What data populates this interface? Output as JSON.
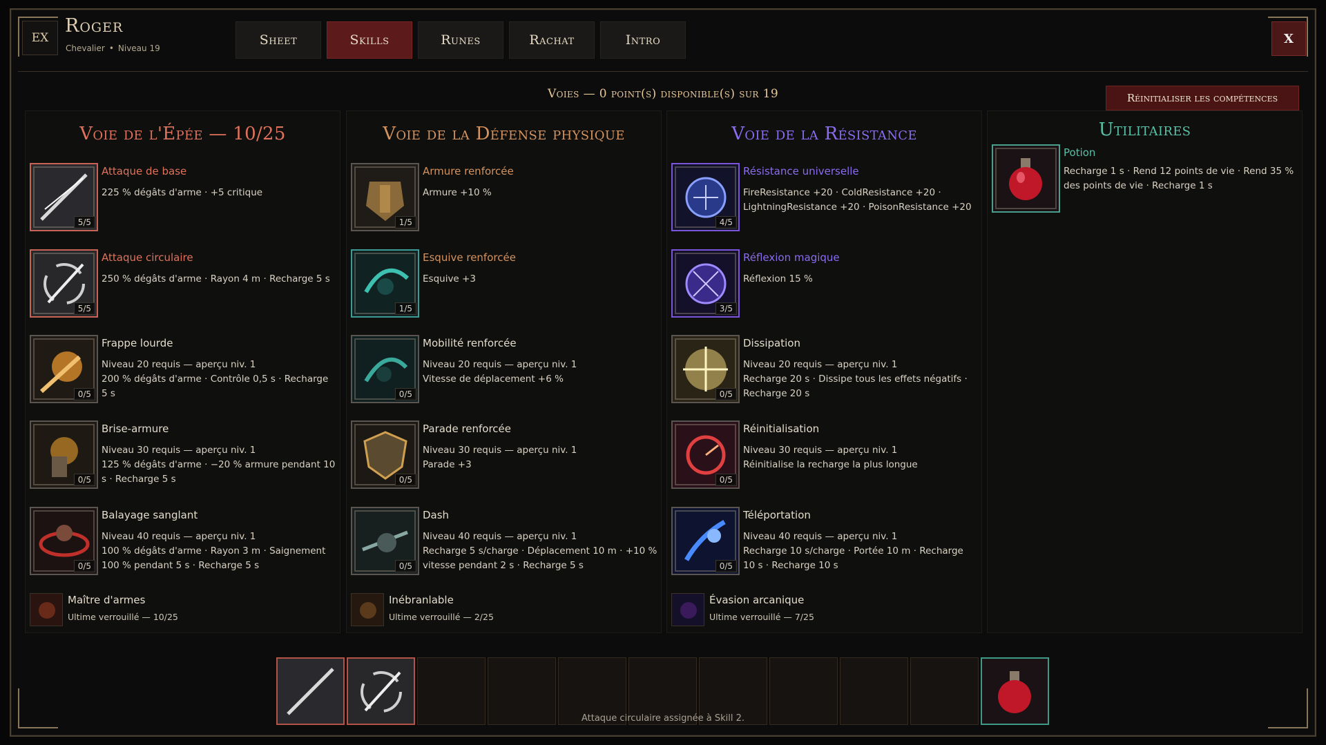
{
  "header": {
    "brand": "EX",
    "name": "Roger",
    "class": "Chevalier",
    "level": "Niveau 19",
    "close": "X"
  },
  "tabs": [
    {
      "label": "Sheet",
      "active": false
    },
    {
      "label": "Skills",
      "active": true
    },
    {
      "label": "Runes",
      "active": false
    },
    {
      "label": "Rachat",
      "active": false
    },
    {
      "label": "Intro",
      "active": false
    }
  ],
  "points_text": "Voies — 0 point(s) disponible(s) sur 19",
  "reset_label": "Réinitialiser les compétences",
  "colors": {
    "epee": "#e0725c",
    "defense": "#d4935e",
    "resist": "#8a6cf0",
    "util": "#58c0a6"
  },
  "paths": {
    "epee": {
      "title": "Voie de l'Épée — 10/25",
      "skills": [
        {
          "name": "Attaque de base",
          "desc": "225 % dégâts d'arme · +5 critique",
          "level": "5/5",
          "icon": "sword-slash-icon"
        },
        {
          "name": "Attaque circulaire",
          "desc": "250 % dégâts d'arme · Rayon 4 m · Recharge 5 s",
          "level": "5/5",
          "icon": "whirlwind-slash-icon"
        },
        {
          "name": "Frappe lourde",
          "desc": "Niveau 20 requis — aperçu niv. 1",
          "desc2": "200 % dégâts d'arme · Contrôle 0,5 s · Recharge 5 s",
          "level": "0/5",
          "icon": "heavy-strike-icon"
        },
        {
          "name": "Brise-armure",
          "desc": "Niveau 30 requis — aperçu niv. 1",
          "desc2": "125 % dégâts d'arme · −20 % armure pendant 10 s · Recharge 5 s",
          "level": "0/5",
          "icon": "armor-break-icon"
        },
        {
          "name": "Balayage sanglant",
          "desc": "Niveau 40 requis — aperçu niv. 1",
          "desc2": "100 % dégâts d'arme · Rayon 3 m · Saignement 100 % pendant 5 s · Recharge 5 s",
          "level": "0/5",
          "icon": "bloody-sweep-icon"
        }
      ],
      "ultimate": {
        "name": "Maître d'armes",
        "lock": "Ultime verrouillé — 10/25"
      }
    },
    "defense": {
      "title": "Voie de la Défense physique",
      "skills": [
        {
          "name": "Armure renforcée",
          "desc": "Armure +10 %",
          "level": "1/5",
          "icon": "armor-icon"
        },
        {
          "name": "Esquive renforcée",
          "desc": "Esquive +3",
          "level": "1/5",
          "icon": "dodge-icon"
        },
        {
          "name": "Mobilité renforcée",
          "desc": "Niveau 20 requis — aperçu niv. 1",
          "desc2": "Vitesse de déplacement +6 %",
          "level": "0/5",
          "icon": "mobility-icon"
        },
        {
          "name": "Parade renforcée",
          "desc": "Niveau 30 requis — aperçu niv. 1",
          "desc2": "Parade +3",
          "level": "0/5",
          "icon": "shield-icon"
        },
        {
          "name": "Dash",
          "desc": "Niveau 40 requis — aperçu niv. 1",
          "desc2": "Recharge 5 s/charge · Déplacement 10 m · +10 % vitesse pendant 2 s · Recharge 5 s",
          "level": "0/5",
          "icon": "dash-icon"
        }
      ],
      "ultimate": {
        "name": "Inébranlable",
        "lock": "Ultime verrouillé — 2/25"
      }
    },
    "resist": {
      "title": "Voie de la Résistance",
      "skills": [
        {
          "name": "Résistance universelle",
          "desc": "FireResistance +20 · ColdResistance +20 ·",
          "desc2": "LightningResistance +20 · PoisonResistance +20",
          "level": "4/5",
          "icon": "resistance-shield-icon"
        },
        {
          "name": "Réflexion magique",
          "desc": "Réflexion 15 %",
          "level": "3/5",
          "icon": "magic-reflect-icon"
        },
        {
          "name": "Dissipation",
          "desc": "Niveau 20 requis — aperçu niv. 1",
          "desc2": "Recharge 20 s · Dissipe tous les effets négatifs · Recharge 20 s",
          "level": "0/5",
          "icon": "dispel-icon"
        },
        {
          "name": "Réinitialisation",
          "desc": "Niveau 30 requis — aperçu niv. 1",
          "desc2": "Réinitialise la recharge la plus longue",
          "level": "0/5",
          "icon": "reset-cooldown-icon"
        },
        {
          "name": "Téléportation",
          "desc": "Niveau 40 requis — aperçu niv. 1",
          "desc2": "Recharge 10 s/charge · Portée 10 m · Recharge 10 s · Recharge 10 s",
          "level": "0/5",
          "icon": "teleport-icon"
        }
      ],
      "ultimate": {
        "name": "Évasion arcanique",
        "lock": "Ultime verrouillé — 7/25"
      }
    },
    "util": {
      "title": "Utilitaires",
      "skills": [
        {
          "name": "Potion",
          "desc": "Recharge 1 s · Rend 12 points de vie · Rend 35 % des points de vie · Recharge 1 s",
          "icon": "potion-icon"
        }
      ]
    }
  },
  "hotbar": {
    "slots": [
      "sword-slash-icon",
      "whirlwind-slash-icon",
      "",
      "",
      "",
      "",
      "",
      "",
      "",
      "",
      "potion-icon"
    ]
  },
  "toast": "Attaque circulaire assignée à Skill 2."
}
